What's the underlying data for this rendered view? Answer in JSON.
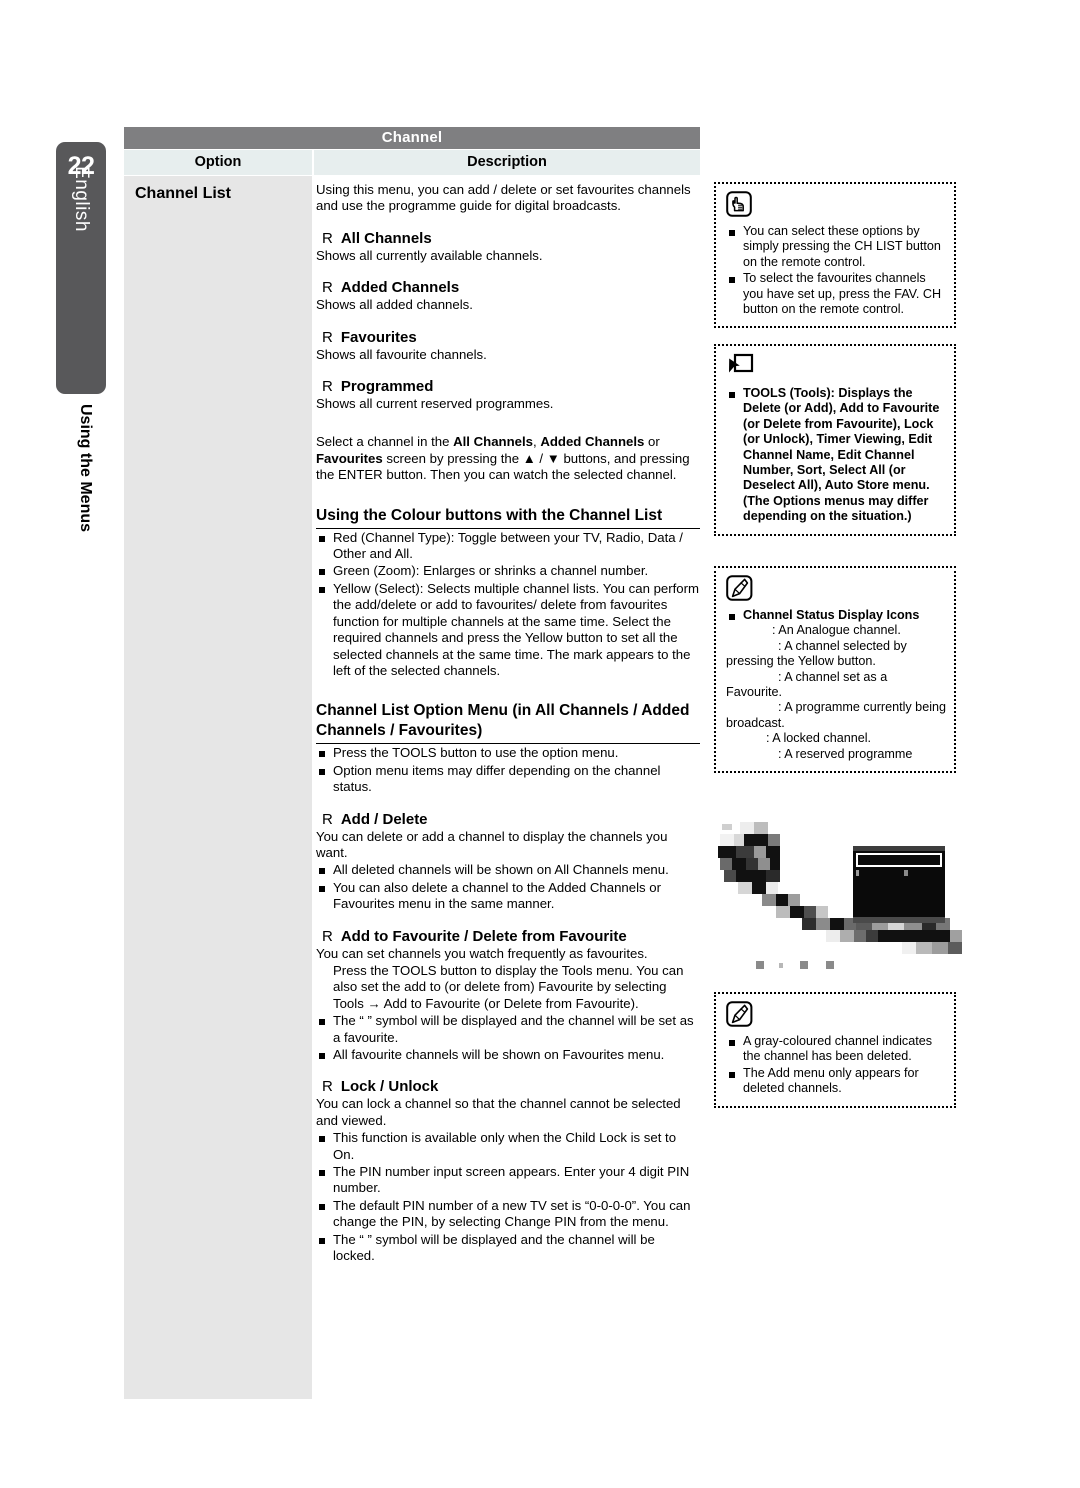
{
  "page": {
    "number": "22",
    "language": "English",
    "chapter": "Using the Menus"
  },
  "table": {
    "title": "Channel",
    "headers": {
      "option": "Option",
      "description": "Description"
    },
    "option_label": "Channel List"
  },
  "description": {
    "intro": "Using this menu, you can add / delete or set favourites channels and use the programme guide for digital broadcasts.",
    "rmark": "R",
    "items": [
      {
        "head": "All Channels",
        "body": "Shows all currently available channels."
      },
      {
        "head": "Added Channels",
        "body": "Shows all added channels."
      },
      {
        "head": "Favourites",
        "body": "Shows all favourite channels."
      },
      {
        "head": "Programmed",
        "body": "Shows all current reserved programmes."
      }
    ],
    "select_para_1": "Select a channel in the ",
    "select_b1": "All Channels",
    "select_para_2": ", ",
    "select_b2": "Added Channels",
    "select_para_3": " or ",
    "select_b3": "Favourites",
    "select_para_4": " screen by pressing the ▲ / ▼ buttons, and pressing the ENTER      button. Then you can watch the selected channel.",
    "colour_section_title": "Using the Colour buttons with the Channel List",
    "colour_bullets": [
      "Red (Channel Type): Toggle between your TV, Radio, Data / Other and All.",
      "Green (Zoom): Enlarges or shrinks a channel number.",
      "Yellow (Select): Selects multiple channel lists. You can perform the add/delete or add to favourites/ delete from favourites function for multiple channels at the same time. Select the required channels and press the Yellow button to set all the selected channels at the same time. The        mark appears to the left of the selected channels."
    ],
    "option_menu_title": "Channel List Option Menu (in All Channels / Added Channels / Favourites)",
    "option_menu_bullets": [
      "Press the TOOLS button to use the option menu.",
      "Option menu items may differ depending on the channel status."
    ],
    "add_delete": {
      "head": "Add / Delete",
      "body": "You can delete or add a channel to display the channels you want.",
      "bullets": [
        "All deleted channels will be shown on All Channels menu.",
        "You can also delete a channel to the Added Channels or Favourites menu in the same manner."
      ]
    },
    "favourite": {
      "head": "Add to Favourite / Delete from Favourite",
      "body": "You can set channels you watch frequently as favourites.",
      "sub": "Press the TOOLS button to display the Tools menu. You can also set the add to (or delete from) Favourite by selecting Tools → Add to Favourite (or Delete from Favourite).",
      "bullets": [
        "The “    ” symbol will be displayed and the channel will be set as a favourite.",
        "All favourite channels will be shown on Favourites menu."
      ]
    },
    "lock": {
      "head": "Lock / Unlock",
      "body": "You can lock a channel so that the channel cannot be selected and viewed.",
      "bullets": [
        "This function is available only when the Child Lock is set to On.",
        "The PIN number input screen appears. Enter your 4 digit PIN number.",
        "The default PIN number of a new TV set is “0-0-0-0”. You can change the PIN, by selecting Change PIN from the menu.",
        "The “    ” symbol will be displayed and the channel will be locked."
      ]
    }
  },
  "notes": {
    "chlist": {
      "icon": "hand-press-icon",
      "bullets": [
        "You can select these options by simply pressing the CH LIST button on the remote control.",
        "To select the favourites channels you have set up, press the FAV. CH button on the remote control."
      ]
    },
    "tools": {
      "icon": "tools-cursor-icon",
      "bullet": "TOOLS (Tools): Displays the Delete (or Add), Add to Favourite (or Delete from Favourite), Lock (or Unlock), Timer Viewing, Edit Channel Name, Edit Channel Number, Sort, Select All (or Deselect All), Auto Store menu. (The Options menus may differ depending on the situation.)"
    },
    "status": {
      "icon": "note-pencil-icon",
      "title": "Channel Status Display Icons",
      "lines": [
        ": An Analogue channel.",
        ": A channel selected by pressing the Yellow button.",
        ": A channel set as a Favourite.",
        ": A programme currently being broadcast.",
        ": A locked channel.",
        ": A reserved programme"
      ]
    },
    "gray": {
      "icon": "note-pencil-icon",
      "bullets": [
        "A gray-coloured channel indicates the channel has been deleted.",
        "The Add menu only appears for deleted channels."
      ]
    }
  },
  "colors": {
    "title_bar": "#7f7f81",
    "header_cell": "#e7eeee",
    "option_column": "#e6e6e6",
    "tab": "#58585a"
  }
}
